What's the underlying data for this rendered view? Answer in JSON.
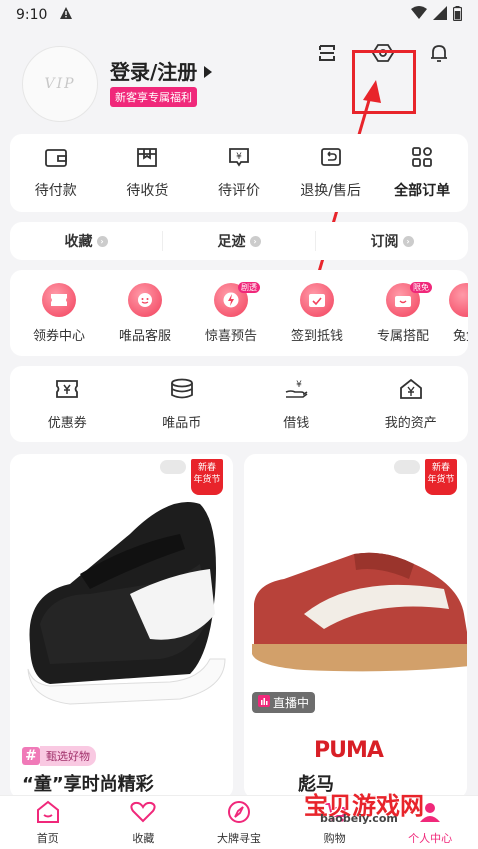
{
  "status": {
    "time": "9:10"
  },
  "header": {
    "avatar_text": "VIP",
    "login_label": "登录/注册",
    "new_badge": "新客享专属福利"
  },
  "orders": [
    {
      "label": "待付款",
      "icon": "wallet-icon"
    },
    {
      "label": "待收货",
      "icon": "package-icon"
    },
    {
      "label": "待评价",
      "icon": "review-icon"
    },
    {
      "label": "退换/售后",
      "icon": "return-icon"
    },
    {
      "label": "全部订单",
      "icon": "grid-icon"
    }
  ],
  "quick": [
    {
      "label": "收藏"
    },
    {
      "label": "足迹"
    },
    {
      "label": "订阅"
    }
  ],
  "services": [
    {
      "label": "领券中心",
      "tag": ""
    },
    {
      "label": "唯品客服",
      "tag": ""
    },
    {
      "label": "惊喜预告",
      "tag": "剧透"
    },
    {
      "label": "签到抵钱",
      "tag": ""
    },
    {
      "label": "专属搭配",
      "tag": "限免"
    },
    {
      "label": "兔兔",
      "tag": ""
    }
  ],
  "assets": [
    {
      "label": "优惠券",
      "icon": "coupon-icon"
    },
    {
      "label": "唯品币",
      "icon": "coin-icon"
    },
    {
      "label": "借钱",
      "icon": "borrow-icon"
    },
    {
      "label": "我的资产",
      "icon": "assets-icon"
    }
  ],
  "products": {
    "left": {
      "spring_tag_1": "新春",
      "spring_tag_2": "年货节",
      "pick_label": "甄选好物",
      "title": "“童”享时尚精彩"
    },
    "right": {
      "spring_tag_1": "新春",
      "spring_tag_2": "年货节",
      "live_label": "直播中",
      "logo": "PUMA",
      "title": "彪马"
    }
  },
  "tabbar": [
    {
      "label": "首页",
      "icon": "home-icon"
    },
    {
      "label": "收藏",
      "icon": "heart-icon"
    },
    {
      "label": "大牌寻宝",
      "icon": "compass-icon"
    },
    {
      "label": "购物",
      "icon": "cart-icon"
    },
    {
      "label": "个人中心",
      "icon": "user-icon"
    }
  ],
  "watermark": {
    "text": "宝贝游戏网",
    "url": "baobeiy.com"
  },
  "colors": {
    "brand_pink": "#f0287a",
    "highlight_red": "#e8242b"
  }
}
